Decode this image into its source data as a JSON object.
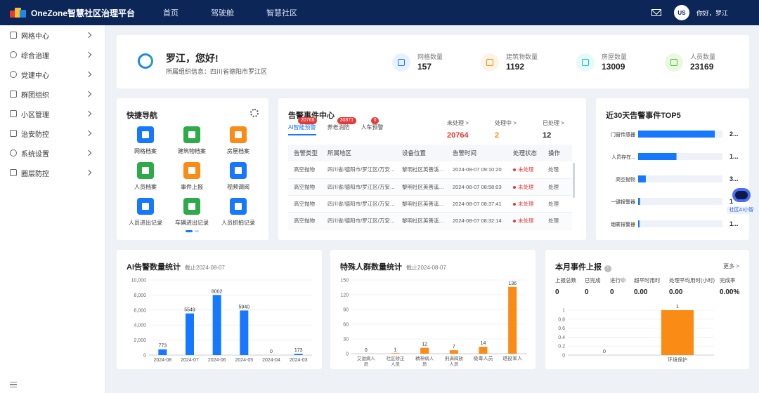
{
  "header": {
    "brand": "OneZone智慧社区治理平台",
    "nav": [
      "首页",
      "驾驶舱",
      "智慧社区"
    ],
    "avatar_text": "US",
    "greeting": "你好，罗江",
    "brand_colors": [
      "#e53935",
      "#fbc02d",
      "#1e88e5"
    ]
  },
  "sidebar": {
    "items": [
      {
        "label": "网格中心",
        "icon": "map-icon"
      },
      {
        "label": "综合治理",
        "icon": "governance-icon"
      },
      {
        "label": "党建中心",
        "icon": "party-icon"
      },
      {
        "label": "群团组织",
        "icon": "group-icon"
      },
      {
        "label": "小区管理",
        "icon": "home-icon"
      },
      {
        "label": "治安防控",
        "icon": "shield-icon"
      },
      {
        "label": "系统设置",
        "icon": "gear-icon"
      },
      {
        "label": "圈层防控",
        "icon": "shield-check-icon"
      }
    ]
  },
  "welcome": {
    "name": "罗江，您好!",
    "org": "所属组织信息：四川省德阳市罗江区",
    "stats": [
      {
        "label": "网格数量",
        "value": "157",
        "icon": "grid-map-icon",
        "color": "#1677ff",
        "bg": "#e8f1ff"
      },
      {
        "label": "建筑物数量",
        "value": "1192",
        "icon": "building-icon",
        "color": "#fa8c16",
        "bg": "#fff3e6"
      },
      {
        "label": "房屋数量",
        "value": "13009",
        "icon": "house-icon",
        "color": "#13c2c2",
        "bg": "#e6fafa"
      },
      {
        "label": "人员数量",
        "value": "23169",
        "icon": "person-icon",
        "color": "#52c41a",
        "bg": "#eaf8e3"
      }
    ]
  },
  "quick_nav": {
    "title": "快捷导航",
    "items": [
      {
        "label": "网格档案",
        "color": "#1677ff",
        "icon": "grid-archive-icon"
      },
      {
        "label": "建筑物档案",
        "color": "#2eaa4a",
        "icon": "building-archive-icon"
      },
      {
        "label": "房屋档案",
        "color": "#fa8c16",
        "icon": "house-archive-icon"
      },
      {
        "label": "人员档案",
        "color": "#2eaa4a",
        "icon": "person-archive-icon"
      },
      {
        "label": "事件上报",
        "color": "#fa8c16",
        "icon": "report-icon"
      },
      {
        "label": "视频调阅",
        "color": "#1677ff",
        "icon": "video-icon"
      },
      {
        "label": "人员进出记录",
        "color": "#1677ff",
        "icon": "person-access-icon"
      },
      {
        "label": "车辆进出记录",
        "color": "#2eaa4a",
        "icon": "car-access-icon"
      },
      {
        "label": "人员抓拍记录",
        "color": "#1677ff",
        "icon": "capture-icon"
      }
    ],
    "accent": "#1677ff"
  },
  "alarm": {
    "title": "告警事件中心",
    "tabs": [
      {
        "label": "AI智能预警",
        "badge": "20766"
      },
      {
        "label": "养老消防",
        "badge": "30871"
      },
      {
        "label": "人车预警",
        "badge": "0"
      }
    ],
    "summary": [
      {
        "label": "未处理 >",
        "value": "20764",
        "color": "#e53935"
      },
      {
        "label": "处理中 >",
        "value": "2",
        "color": "#fa8c16"
      },
      {
        "label": "已处理 >",
        "value": "12",
        "color": "#222222"
      }
    ],
    "columns": [
      "告警类型",
      "所属地区",
      "设备位置",
      "告警时间",
      "处理状态",
      "操作"
    ],
    "rows": [
      [
        "高空抛物",
        "四川省/德阳市/罗江区/万安镇...",
        "黎明社区英善溪苑...",
        "2024-08-07 09:10:20",
        "未处理",
        "处理"
      ],
      [
        "高空抛物",
        "四川省/德阳市/罗江区/万安镇...",
        "黎明社区英善溪苑...",
        "2024-08-07 08:58:03",
        "未处理",
        "处理"
      ],
      [
        "高空抛物",
        "四川省/德阳市/罗江区/万安镇...",
        "黎明社区英善溪苑...",
        "2024-08-07 08:37:41",
        "未处理",
        "处理"
      ],
      [
        "高空抛物",
        "四川省/德阳市/罗江区/万安镇...",
        "黎明社区英善溪苑...",
        "2024-08-07 08:32:14",
        "未处理",
        "处理"
      ]
    ]
  },
  "top5": {
    "title": "近30天告警事件TOP5",
    "items": [
      {
        "label": "门窗传感器",
        "value": 2,
        "display": "2..."
      },
      {
        "label": "人员存在...",
        "value": 1,
        "display": "1..."
      },
      {
        "label": "高空抛物",
        "value": 0.2,
        "display": "3..."
      },
      {
        "label": "一键报警器",
        "value": 0.05,
        "display": "1"
      },
      {
        "label": "烟雾报警器",
        "value": 0.03,
        "display": "1..."
      }
    ]
  },
  "ai_chart": {
    "title": "AI告警数量统计",
    "subtitle": "截止2024-08-07"
  },
  "special_chart": {
    "title": "特殊人群数量统计",
    "subtitle": "截止2024-08-07"
  },
  "month_report": {
    "title": "本月事件上报",
    "more": "更多 >",
    "summary": [
      {
        "label": "上报总数",
        "value": "0"
      },
      {
        "label": "已完成",
        "value": "0"
      },
      {
        "label": "进行中",
        "value": "0"
      },
      {
        "label": "超平时用时",
        "value": "0.00"
      },
      {
        "label": "处理平均用时(小时)",
        "value": "0.00"
      },
      {
        "label": "完成率",
        "value": "0.00%"
      }
    ]
  },
  "robot": {
    "label": "社区AI小智"
  },
  "chart_data": [
    {
      "type": "bar",
      "categories": [
        "2024-08",
        "2024-07",
        "2024-06",
        "2024-05",
        "2024-04",
        "2024-03"
      ],
      "values": [
        773,
        5549,
        8002,
        5940,
        0,
        173
      ],
      "ylim": [
        0,
        10000
      ],
      "yticks": [
        "0",
        "2,000",
        "4,000",
        "6,000",
        "8,000",
        "10,000"
      ],
      "color": "#1677ff",
      "grid": true
    },
    {
      "type": "bar",
      "categories": [
        "艾滋病人员",
        "社区矫正人员",
        "精神病人员",
        "刑满释放人员",
        "吸毒人员",
        "退役军人"
      ],
      "values": [
        0,
        1,
        12,
        7,
        14,
        136
      ],
      "ylim": [
        0,
        150
      ],
      "yticks": [
        "0",
        "30",
        "60",
        "90",
        "120",
        "150"
      ],
      "color": "#fa8c16",
      "grid": true
    },
    {
      "type": "bar",
      "categories": [
        "",
        "环境保护"
      ],
      "values": [
        0,
        1
      ],
      "ylim": [
        0,
        1
      ],
      "yticks": [
        "0",
        "0.2",
        "0.4",
        "0.6",
        "0.8",
        "1"
      ],
      "color": "#fa8c16",
      "grid": true
    }
  ]
}
